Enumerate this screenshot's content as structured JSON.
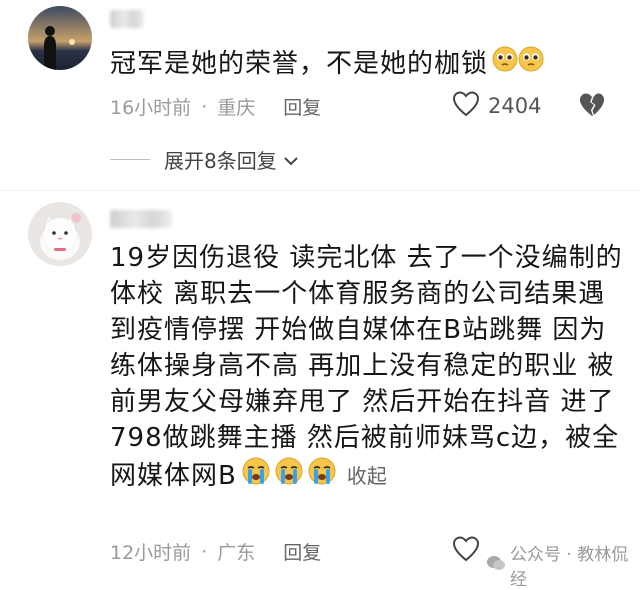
{
  "comments": [
    {
      "text": "冠军是她的荣誉，不是她的枷锁",
      "emoji": [
        "pleading-face",
        "pleading-face"
      ],
      "time": "16小时前",
      "location": "重庆",
      "reply_label": "回复",
      "likes": "2404",
      "expand_label": "展开8条回复"
    },
    {
      "lines": [
        "19岁因伤退役 读完北体 去了一个没编制的",
        "体校 离职去一个体育服务商的公司结果遇",
        "到疫情停摆 开始做自媒体在B站跳舞 因为",
        "练体操身高不高 再加上没有稳定的职业 被",
        "前男友父母嫌弃甩了 然后开始在抖音 进了",
        "798做跳舞主播 然后被前师妹骂c边，被全",
        "网媒体网B"
      ],
      "emoji": [
        "crying-face",
        "crying-face",
        "crying-face"
      ],
      "collapse_label": "收起",
      "time": "12小时前",
      "location": "广东",
      "reply_label": "回复"
    }
  ],
  "watermark": {
    "text": "公众号 · 教林侃经"
  },
  "colors": {
    "meta": "#9a9a9a",
    "text": "#161616",
    "emoji_yellow": "#f6c64a",
    "tear_blue": "#3aa3e8"
  }
}
